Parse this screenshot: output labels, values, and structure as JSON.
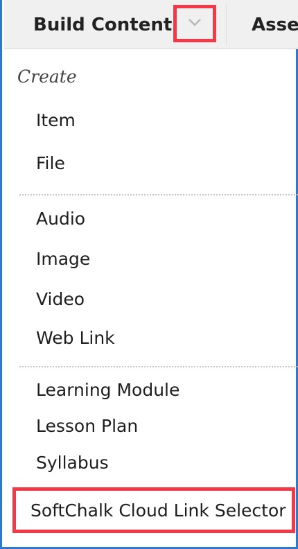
{
  "toolbar": {
    "build_content_label": "Build Content",
    "assessments_label_partial": "Asse"
  },
  "menu": {
    "section_heading": "Create",
    "items": [
      {
        "label": "Item"
      },
      {
        "label": "File"
      },
      {
        "label": "Audio"
      },
      {
        "label": "Image"
      },
      {
        "label": "Video"
      },
      {
        "label": "Web Link"
      },
      {
        "label": "Learning Module"
      },
      {
        "label": "Lesson Plan"
      },
      {
        "label": "Syllabus"
      },
      {
        "label": "SoftChalk Cloud Link Selector"
      }
    ]
  },
  "icons": {
    "dropdown": "chevron-down-icon"
  },
  "colors": {
    "frame_border": "#2b7ad0",
    "highlight_box": "#f03a47",
    "toolbar_bg": "#f0f0f0"
  }
}
